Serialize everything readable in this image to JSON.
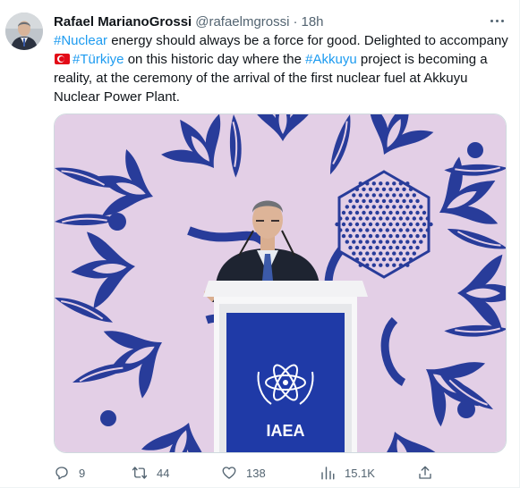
{
  "tweet": {
    "author": {
      "display_name": "Rafael MarianoGrossi",
      "handle": "@rafaelmgrossi",
      "separator": "·",
      "time": "18h"
    },
    "text": {
      "t1": "#Nuclear",
      "t2": " energy should always be a force for good. Delighted to accompany ",
      "t3": "#Türkiye",
      "t4": " on this historic day where the ",
      "t5": "#Akkuyu",
      "t6": " project is becoming a reality, at the ceremony of the arrival of the first nuclear fuel at Akkuyu Nuclear Power Plant."
    },
    "flag_icon": "turkey-flag-emoji",
    "media": {
      "podium_logo_text": "IAEA"
    },
    "actions": {
      "replies": "9",
      "retweets": "44",
      "likes": "138",
      "views": "15.1K"
    }
  },
  "colors": {
    "link": "#1d9bf0",
    "muted": "#536471",
    "backdrop": "#e3cfe6",
    "pattern": "#283c9a",
    "podium_panel": "#1f3aa7"
  }
}
